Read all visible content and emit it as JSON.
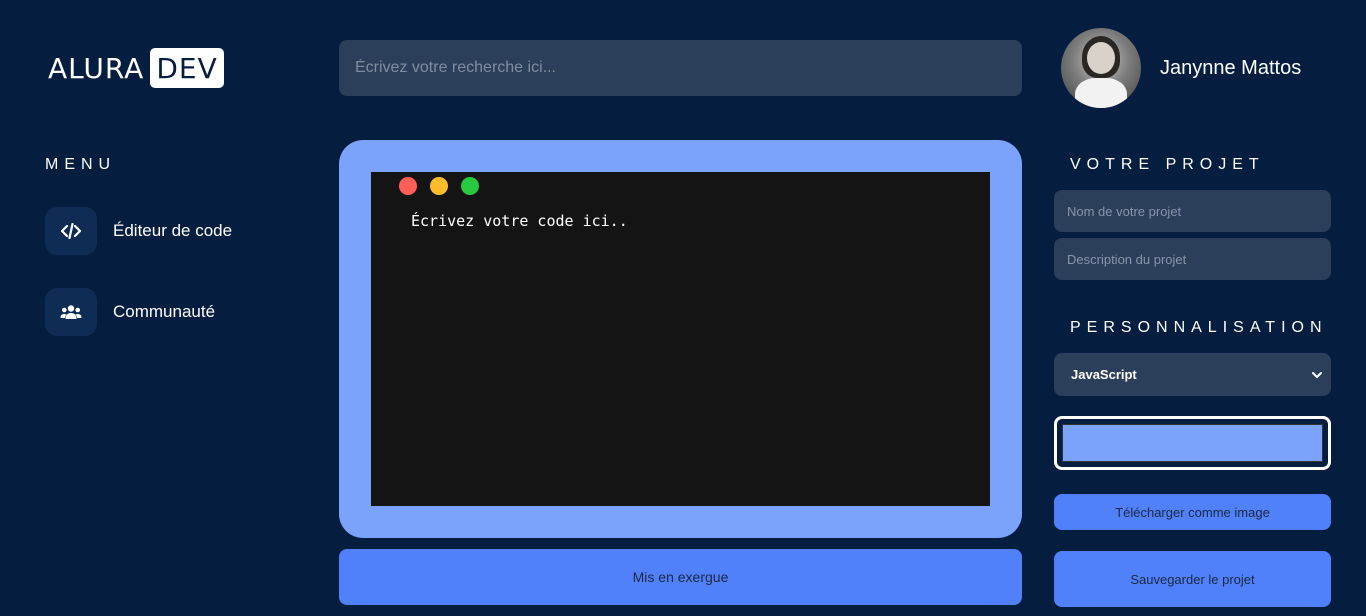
{
  "logo": {
    "brand": "ALURA",
    "badge": "DEV"
  },
  "search": {
    "placeholder": "Écrivez votre recherche ici..."
  },
  "profile": {
    "name": "Janynne Mattos"
  },
  "menu": {
    "title": "MENU",
    "items": [
      {
        "label": "Éditeur de code",
        "icon": "code-icon"
      },
      {
        "label": "Communauté",
        "icon": "users-icon"
      }
    ]
  },
  "editor": {
    "placeholder_code": "Écrivez votre code ici..",
    "frame_color": "#7ba3fb",
    "window_dots": [
      "#ff5f56",
      "#ffbd2e",
      "#27c93f"
    ]
  },
  "highlight_button": {
    "label": "Mis en exergue"
  },
  "project": {
    "title": "VOTRE PROJET",
    "name_placeholder": "Nom de votre projet",
    "description_placeholder": "Description du projet"
  },
  "customization": {
    "title": "PERSONNALISATION",
    "language_selected": "JavaScript",
    "color_value": "#7ba3fb"
  },
  "actions": {
    "download_label": "Télécharger comme image",
    "save_label": "Sauvegarder le projet"
  },
  "colors": {
    "background": "#051d3f",
    "input_bg": "#2c3f5a",
    "accent": "#5081fb"
  }
}
